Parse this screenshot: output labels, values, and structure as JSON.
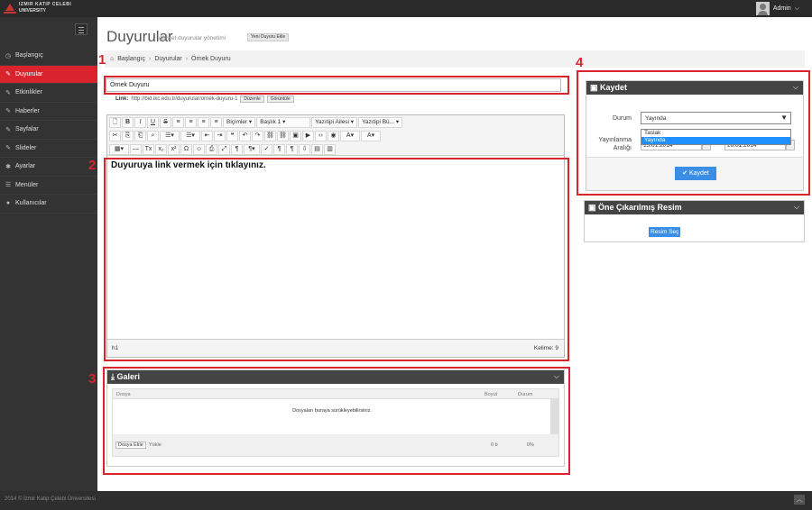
{
  "topbar": {
    "logo_line1": "IZMIR KATIP CELEBI",
    "logo_line2": "UNIVERSITY",
    "user_name": "Admin",
    "caret": "⌵"
  },
  "sidebar": {
    "items": [
      {
        "label": "Başlangıç",
        "icon": "gauge-icon",
        "glyph": "◷"
      },
      {
        "label": "Duyurular",
        "icon": "edit-icon",
        "glyph": "✎",
        "active": true
      },
      {
        "label": "Etkinlikler",
        "icon": "edit-icon",
        "glyph": "✎"
      },
      {
        "label": "Haberler",
        "icon": "edit-icon",
        "glyph": "✎"
      },
      {
        "label": "Sayfalar",
        "icon": "edit-icon",
        "glyph": "✎"
      },
      {
        "label": "Slideler",
        "icon": "edit-icon",
        "glyph": "✎"
      },
      {
        "label": "Ayarlar",
        "icon": "gear-icon",
        "glyph": "✱"
      },
      {
        "label": "Menüler",
        "icon": "list-icon",
        "glyph": "☰"
      },
      {
        "label": "Kullanıcılar",
        "icon": "user-icon",
        "glyph": "●"
      }
    ]
  },
  "page": {
    "title": "Duyurular",
    "subtitle": "güncel duyurular yönetimi",
    "new_button": "Yeni Duyuru Ekle"
  },
  "breadcrumb": {
    "home_icon": "⌂",
    "items": [
      "Başlangıç",
      "Duyurular",
      "Örnek Duyuru"
    ],
    "sep": "›"
  },
  "annotations": [
    "1",
    "2",
    "3",
    "4"
  ],
  "editor": {
    "title_value": "Örnek Duyuru",
    "link_label": "Link:",
    "link_url": "http://bid.ikc.edu.tr/duyurular/ornek-duyuru-1",
    "edit_button": "Düzenle",
    "view_button": "Görüntüle",
    "toolbar_row1": [
      "🗋",
      "B",
      "I",
      "U",
      "S",
      "≡",
      "≡",
      "≡",
      "≡"
    ],
    "dropdowns": [
      "Biçimler ▾",
      "Başlık 1 ▾",
      "Yazıtipi Ailesi ▾",
      "Yazıtipi Bü... ▾"
    ],
    "toolbar_row2": [
      "✂",
      "⎘",
      "⎗",
      "⌕",
      "☰▾",
      "☰▾",
      "⇤",
      "⇥",
      "❝",
      "↶",
      "↷",
      "⛓",
      "⛓",
      "▣",
      "▶",
      "‹›",
      "◉",
      "A▾",
      "A▾"
    ],
    "toolbar_row3": [
      "▦▾",
      "—",
      "Tx",
      "x₂",
      "x²",
      "Ω",
      "☺",
      "⎙",
      "⤢",
      "¶",
      "¶▾",
      "✓",
      "¶",
      "¶",
      "⇩",
      "▤",
      "▥"
    ],
    "content": "Duyuruya link vermek için tıklayınız.",
    "path": "h1",
    "word_count": "Kelime: 9"
  },
  "galeri": {
    "title": "Galeri",
    "icon": "download-icon",
    "glyph": "⤓",
    "chev": "⌵",
    "col_file": "Dosya",
    "col_size": "Boyut",
    "col_status": "Durum",
    "drop_text": "Dosyaları buraya sürükleyebilirsiniz.",
    "add_button": "Dosya Ekle",
    "upload_button": "Yükle",
    "total_size": "0 b",
    "percent": "0%"
  },
  "kaydet": {
    "title": "Kaydet",
    "glyph": "▣",
    "chev": "⌵",
    "durum_label": "Durum",
    "durum_value": "Yayında",
    "arrow": "▼",
    "options": [
      "Taslak",
      "Yayında"
    ],
    "yayin_label1": "Yayınlanma",
    "yayin_label2": "Aralığı",
    "date1": "15.01.2014",
    "date2": "28.01.2014",
    "save_button": "✔ Kaydet"
  },
  "resim": {
    "title": "Öne Çıkarılmış Resim",
    "glyph": "▣",
    "chev": "⌵",
    "button": "Resim Seç"
  },
  "footer": {
    "text": "2014 © İzmir Katip Çelebi Üniversitesi",
    "totop": "︿"
  },
  "colors": {
    "accent": "#d9232d",
    "sidebar": "#333333",
    "topbar": "#2a2a2a",
    "button_blue": "#3a8ee6"
  }
}
